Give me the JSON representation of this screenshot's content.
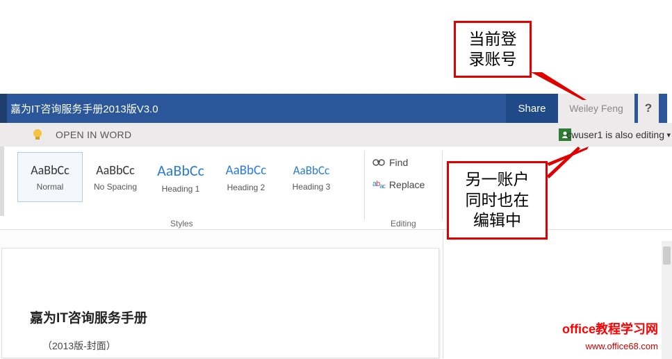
{
  "callouts": {
    "current_account": "当前登\n录账号",
    "other_editor": "另一账户\n同时也在\n编辑中"
  },
  "titlebar": {
    "document_title": "嘉为IT咨询服务手册2013版V3.0",
    "share": "Share",
    "user": "Weiley Feng",
    "help": "?"
  },
  "infobar": {
    "open_in_word": "OPEN IN WORD",
    "coauthor_message": "cwuser1 is also editing"
  },
  "ribbon": {
    "styles": [
      {
        "preview": "AaBbCc",
        "label": "Normal",
        "color": "normal",
        "selected": true
      },
      {
        "preview": "AaBbCc",
        "label": "No Spacing",
        "color": "normal",
        "selected": false
      },
      {
        "preview": "AaBbCc",
        "label": "Heading 1",
        "color": "blue",
        "selected": false
      },
      {
        "preview": "AaBbCc",
        "label": "Heading 2",
        "color": "blue",
        "selected": false
      },
      {
        "preview": "AaBbCc",
        "label": "Heading 3",
        "color": "blue",
        "selected": false
      }
    ],
    "styles_caption": "Styles",
    "editing": {
      "find": "Find",
      "replace": "Replace"
    },
    "editing_caption": "Editing"
  },
  "document": {
    "heading": "嘉为IT咨询服务手册",
    "subtext": "（2013版-封面）"
  },
  "watermark": {
    "line1": "office教程学习网",
    "line2": "www.office68.com"
  }
}
